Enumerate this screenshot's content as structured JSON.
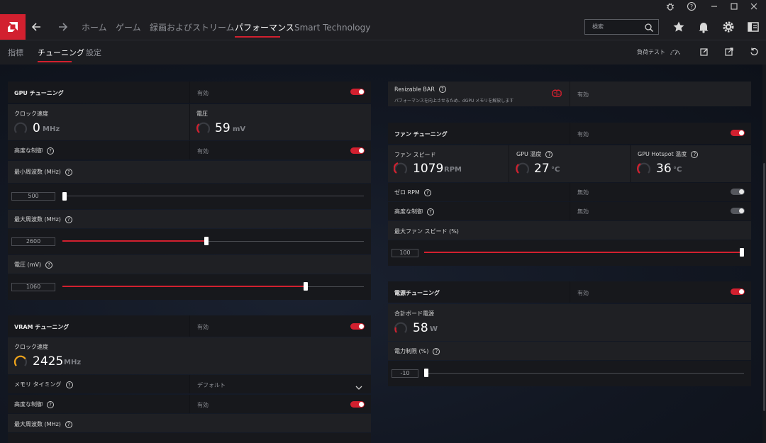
{
  "nav": {
    "home": "ホーム",
    "gaming": "ゲーム",
    "record": "録画およびストリーム",
    "performance": "パフォーマンス",
    "smart": "Smart Technology",
    "search_placeholder": "検索"
  },
  "subnav": {
    "metrics": "指標",
    "tuning": "チューニング",
    "settings": "設定",
    "stress_test": "負荷テスト"
  },
  "gpu_tuning": {
    "title": "GPU チューニング",
    "status": "有効",
    "clock_label": "クロック速度",
    "clock_value": "0",
    "clock_unit": "MHz",
    "voltage_label": "電圧",
    "voltage_value": "59",
    "voltage_unit": "mV",
    "advanced_label": "高度な制御",
    "advanced_status": "有効",
    "min_freq_label": "最小周波数 (MHz)",
    "min_freq_value": "500",
    "min_freq_fraction": 0.0,
    "max_freq_label": "最大周波数 (MHz)",
    "max_freq_value": "2600",
    "max_freq_fraction": 0.47,
    "voltage_mv_label": "電圧 (mV)",
    "voltage_mv_value": "1060",
    "voltage_mv_fraction": 0.8
  },
  "vram_tuning": {
    "title": "VRAM チューニング",
    "status": "有効",
    "clock_label": "クロック速度",
    "clock_value": "2425",
    "clock_unit": "MHz",
    "timing_label": "メモリ タイミング",
    "timing_value": "デフォルト",
    "advanced_label": "高度な制御",
    "advanced_status": "有効",
    "max_freq_label": "最大周波数 (MHz)"
  },
  "resizable_bar": {
    "title": "Resizable BAR",
    "description": "パフォーマンスを向上させるため、dGPU メモリを解放します",
    "status": "有効"
  },
  "fan_tuning": {
    "title": "ファン チューニング",
    "status": "有効",
    "speed_label": "ファン スピード",
    "speed_value": "1079",
    "speed_unit": "RPM",
    "gpu_temp_label": "GPU 温度",
    "gpu_temp_value": "27",
    "gpu_temp_unit": "°C",
    "hotspot_label": "GPU Hotspot 温度",
    "hotspot_value": "36",
    "hotspot_unit": "°C",
    "zero_rpm_label": "ゼロ RPM",
    "zero_rpm_status": "無効",
    "advanced_label": "高度な制御",
    "advanced_status": "無効",
    "max_speed_label": "最大ファン スピード (%)",
    "max_speed_value": "100",
    "max_speed_fraction": 1.0
  },
  "power_tuning": {
    "title": "電源チューニング",
    "status": "有効",
    "board_power_label": "合計ボード電源",
    "board_power_value": "58",
    "board_power_unit": "W",
    "limit_label": "電力制限 (%)",
    "limit_value": "-10",
    "limit_fraction": 0.0
  },
  "colors": {
    "accent": "#d2202f",
    "gauge_amber": "#f2a51a"
  }
}
